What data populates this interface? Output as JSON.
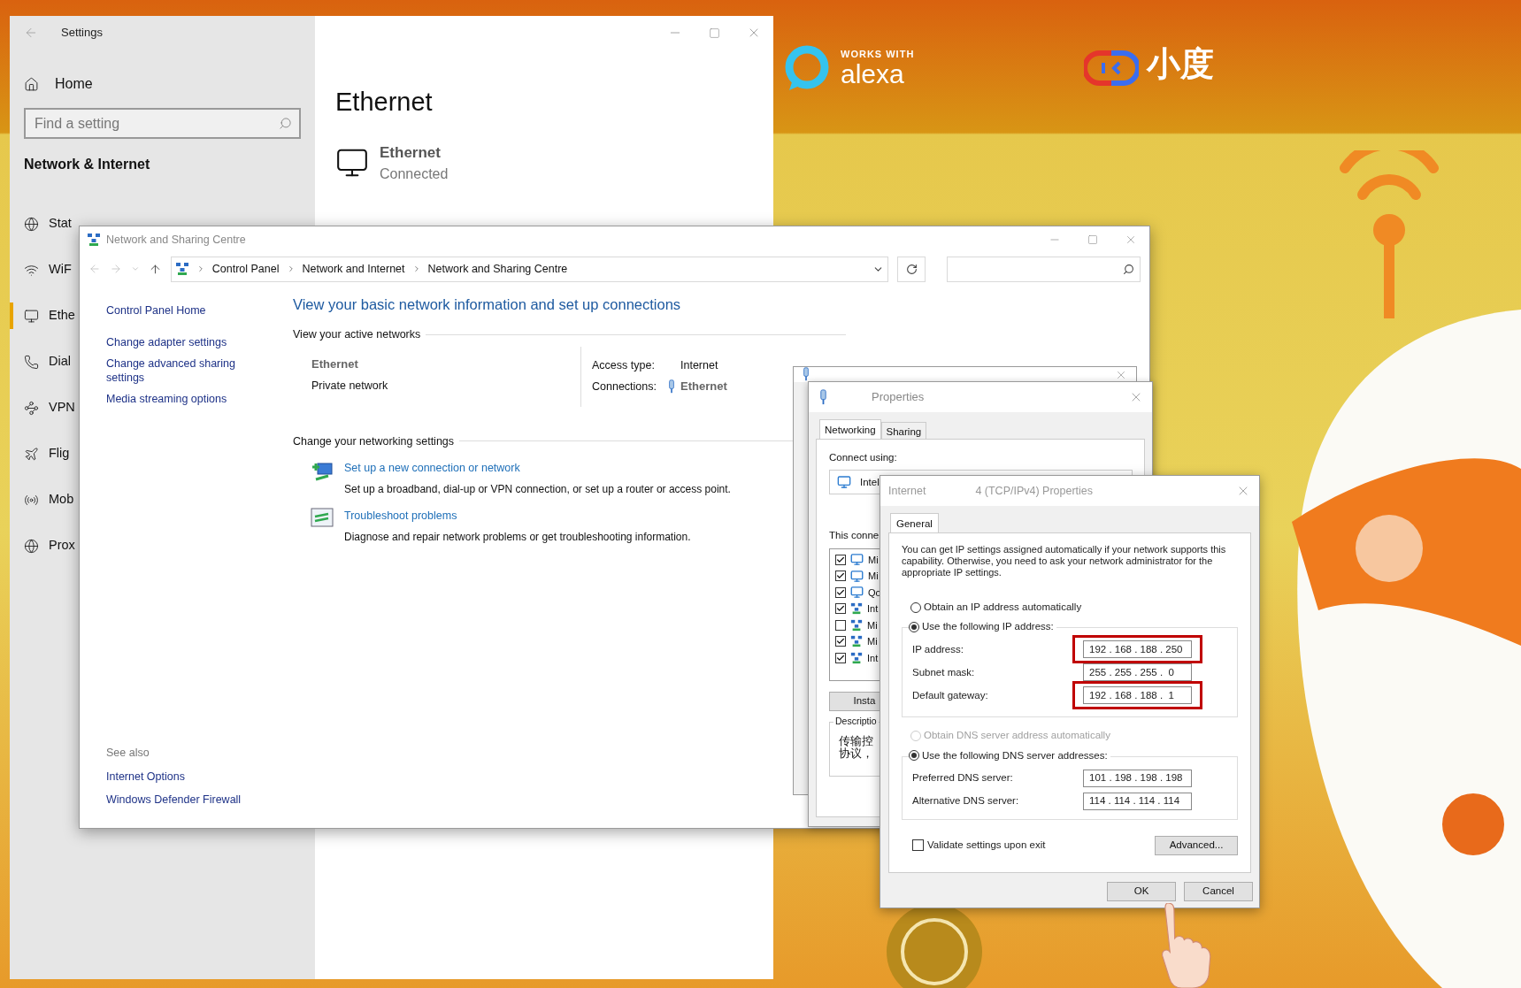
{
  "background": {
    "badge_top": "WORKS WITH",
    "badge_main": "alexa",
    "brand": "小度"
  },
  "settings": {
    "title": "Settings",
    "home": "Home",
    "search": {
      "placeholder": "Find a setting"
    },
    "section": "Network & Internet",
    "nav": [
      {
        "label": "Stat",
        "selected": false
      },
      {
        "label": "WiF",
        "selected": false
      },
      {
        "label": "Ethe",
        "selected": true
      },
      {
        "label": "Dial",
        "selected": false
      },
      {
        "label": "VPN",
        "selected": false
      },
      {
        "label": "Flig",
        "selected": false
      },
      {
        "label": "Mob",
        "selected": false
      },
      {
        "label": "Prox",
        "selected": false
      }
    ],
    "page_title": "Ethernet",
    "connection": {
      "name": "Ethernet",
      "status": "Connected"
    }
  },
  "network_centre": {
    "title": "Network and Sharing Centre",
    "breadcrumb": [
      "Control Panel",
      "Network and Internet",
      "Network and Sharing Centre"
    ],
    "sidebar_links": [
      "Control Panel Home",
      "Change adapter settings",
      "Change advanced sharing settings",
      "Media streaming options"
    ],
    "see_also": {
      "heading": "See also",
      "links": [
        "Internet Options",
        "Windows Defender Firewall"
      ]
    },
    "heading": "View your basic network information and set up connections",
    "active_networks": {
      "label": "View your active networks",
      "name": "Ethernet",
      "category": "Private network",
      "access_type_label": "Access type:",
      "access_type": "Internet",
      "connections_label": "Connections:",
      "connection": "Ethernet"
    },
    "change_settings": {
      "label": "Change your networking settings",
      "tasks": [
        {
          "kind": "setup",
          "link": "Set up a new connection or network",
          "description": "Set up a broadband, dial-up or VPN connection, or set up a router or access point."
        },
        {
          "kind": "troubleshoot",
          "link": "Troubleshoot problems",
          "description": "Diagnose and repair network problems or get troubleshooting information."
        }
      ]
    }
  },
  "properties": {
    "title": "Properties",
    "tabs": [
      {
        "label": "Networking",
        "selected": true
      },
      {
        "label": "Sharing",
        "selected": false
      }
    ],
    "connect_using": "Connect using:",
    "adapter": "Intel",
    "items_label": "This conne",
    "items": [
      {
        "kind": "client",
        "label": "Mi",
        "checked": true
      },
      {
        "kind": "client",
        "label": "Mi",
        "checked": true
      },
      {
        "kind": "client",
        "label": "Qo",
        "checked": true
      },
      {
        "kind": "protocol",
        "label": "Int",
        "checked": true
      },
      {
        "kind": "protocol",
        "label": "Mi",
        "checked": false
      },
      {
        "kind": "protocol",
        "label": "Mi",
        "checked": true
      },
      {
        "kind": "protocol",
        "label": "Int",
        "checked": true
      }
    ],
    "install_button": "Insta",
    "description_label": "Descriptio",
    "description": [
      "传输控",
      "协议，"
    ]
  },
  "ipv4": {
    "title_left": "Internet",
    "title_right": "4 (TCP/IPv4) Properties",
    "tabs": [
      {
        "label": "General",
        "selected": true
      }
    ],
    "intro": "You can get IP settings assigned automatically if your network supports this capability. Otherwise, you need to ask your network administrator for the appropriate IP settings.",
    "ip_auto": {
      "label": "Obtain an IP address automatically",
      "selected": false,
      "disabled": false
    },
    "ip_manual": {
      "label": "Use the following IP address:",
      "selected": true,
      "disabled": false
    },
    "ip_fields": [
      {
        "label": "IP address:",
        "value": "192 . 168 . 188 . 250",
        "highlighted": true
      },
      {
        "label": "Subnet mask:",
        "value": "255 . 255 . 255 .  0",
        "highlighted": false
      },
      {
        "label": "Default gateway:",
        "value": "192 . 168 . 188 .  1",
        "highlighted": true
      }
    ],
    "dns_auto": {
      "label": "Obtain DNS server address automatically",
      "selected": false,
      "disabled": true
    },
    "dns_manual": {
      "label": "Use the following DNS server addresses:",
      "selected": true,
      "disabled": false
    },
    "dns_fields": [
      {
        "label": "Preferred DNS server:",
        "value": "101 . 198 . 198 . 198",
        "highlighted": false
      },
      {
        "label": "Alternative DNS server:",
        "value": "114 . 114 . 114 . 114",
        "highlighted": false
      }
    ],
    "validate": {
      "label": "Validate settings upon exit",
      "checked": false
    },
    "advanced_button": "Advanced...",
    "ok_button": "OK",
    "cancel_button": "Cancel"
  }
}
